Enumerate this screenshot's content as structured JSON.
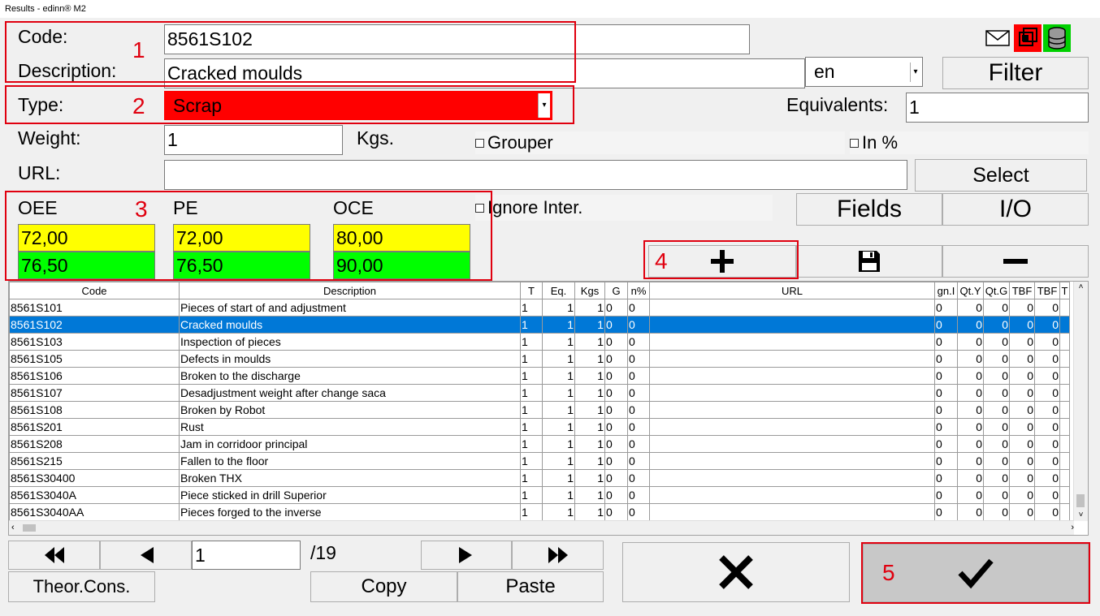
{
  "window": {
    "title": "Results - edinn® M2"
  },
  "form": {
    "code_label": "Code:",
    "code_value": "8561S102",
    "description_label": "Description:",
    "description_value": "Cracked moulds",
    "language_value": "en",
    "filter_label": "Filter",
    "type_label": "Type:",
    "type_value": "Scrap",
    "equivalents_label": "Equivalents:",
    "equivalents_value": "1",
    "weight_label": "Weight:",
    "weight_value": "1",
    "weight_unit": "Kgs.",
    "grouper_label": "Grouper",
    "inpct_label": "In %",
    "url_label": "URL:",
    "url_value": "",
    "select_label": "Select",
    "ignore_label": "Ignore Inter.",
    "fields_label": "Fields",
    "io_label": "I/O",
    "oee_label": "OEE",
    "pe_label": "PE",
    "oce_label": "OCE",
    "oee_top": "72,00",
    "oee_bottom": "76,50",
    "pe_top": "72,00",
    "pe_bottom": "76,50",
    "oce_top": "80,00",
    "oce_bottom": "90,00"
  },
  "annotations": [
    "1",
    "2",
    "3",
    "4",
    "5"
  ],
  "colors": {
    "type_red": "#ff0000",
    "yellow": "#ffff00",
    "green": "#00ff00",
    "selection": "#0078d7",
    "annotation": "#e0000f"
  },
  "table": {
    "columns": [
      "Code",
      "Description",
      "T",
      "Eq.",
      "Kgs",
      "G",
      "n%",
      "URL",
      "gn.I",
      "Qt.Y",
      "Qt.G",
      "TBF",
      "TBF",
      "T"
    ],
    "rows": [
      [
        "8561S101",
        "Pieces of start of and adjustment",
        "1",
        "1",
        "1",
        "0",
        "0",
        "",
        "0",
        "0",
        "0",
        "0",
        "0"
      ],
      [
        "8561S102",
        "Cracked moulds",
        "1",
        "1",
        "1",
        "0",
        "0",
        "",
        "0",
        "0",
        "0",
        "0",
        "0"
      ],
      [
        "8561S103",
        "Inspection of pieces",
        "1",
        "1",
        "1",
        "0",
        "0",
        "",
        "0",
        "0",
        "0",
        "0",
        "0"
      ],
      [
        "8561S105",
        "Defects in moulds",
        "1",
        "1",
        "1",
        "0",
        "0",
        "",
        "0",
        "0",
        "0",
        "0",
        "0"
      ],
      [
        "8561S106",
        "Broken to the discharge",
        "1",
        "1",
        "1",
        "0",
        "0",
        "",
        "0",
        "0",
        "0",
        "0",
        "0"
      ],
      [
        "8561S107",
        "Desadjustment weight after change saca",
        "1",
        "1",
        "1",
        "0",
        "0",
        "",
        "0",
        "0",
        "0",
        "0",
        "0"
      ],
      [
        "8561S108",
        "Broken by Robot",
        "1",
        "1",
        "1",
        "0",
        "0",
        "",
        "0",
        "0",
        "0",
        "0",
        "0"
      ],
      [
        "8561S201",
        "Rust",
        "1",
        "1",
        "1",
        "0",
        "0",
        "",
        "0",
        "0",
        "0",
        "0",
        "0"
      ],
      [
        "8561S208",
        "Jam in corridoor principal",
        "1",
        "1",
        "1",
        "0",
        "0",
        "",
        "0",
        "0",
        "0",
        "0",
        "0"
      ],
      [
        "8561S215",
        "Fallen to the floor",
        "1",
        "1",
        "1",
        "0",
        "0",
        "",
        "0",
        "0",
        "0",
        "0",
        "0"
      ],
      [
        "8561S30400",
        "Broken THX",
        "1",
        "1",
        "1",
        "0",
        "0",
        "",
        "0",
        "0",
        "0",
        "0",
        "0"
      ],
      [
        "8561S3040A",
        "Piece sticked in drill Superior",
        "1",
        "1",
        "1",
        "0",
        "0",
        "",
        "0",
        "0",
        "0",
        "0",
        "0"
      ],
      [
        "8561S3040AA",
        "Pieces forged to the inverse",
        "1",
        "1",
        "1",
        "0",
        "0",
        "",
        "0",
        "0",
        "0",
        "0",
        "0"
      ]
    ],
    "selected_row": 1
  },
  "pager": {
    "page": "1",
    "total": "/19"
  },
  "bottom": {
    "theor_label": "Theor.Cons.",
    "copy_label": "Copy",
    "paste_label": "Paste"
  }
}
